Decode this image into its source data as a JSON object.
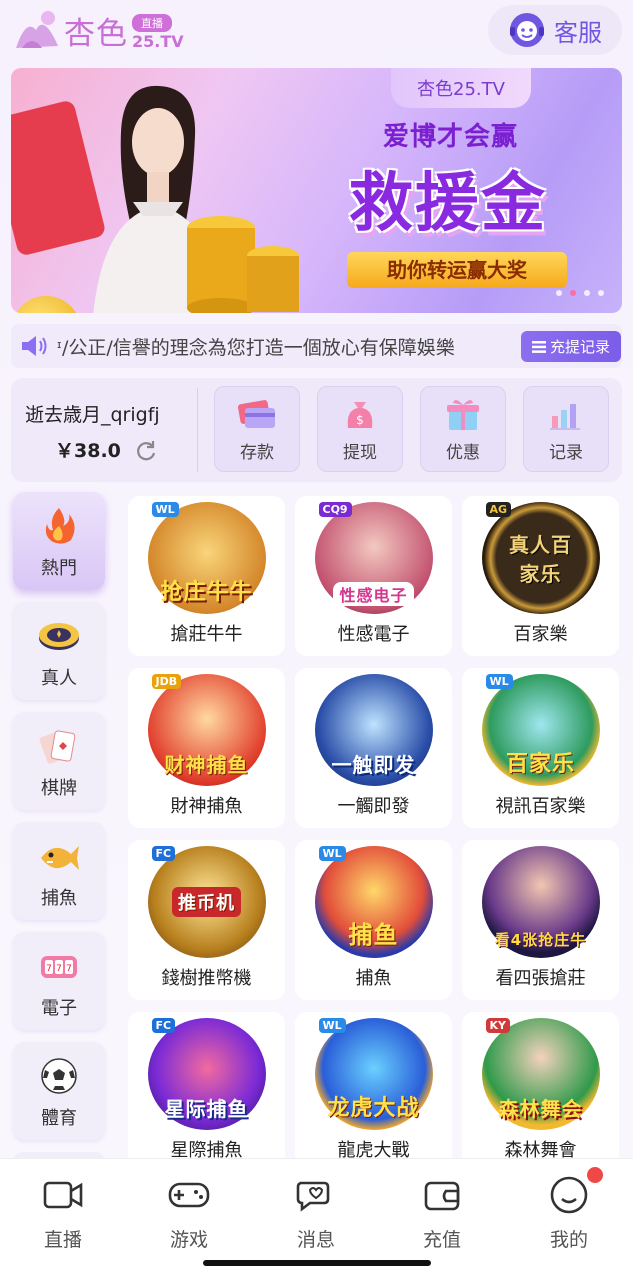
{
  "header": {
    "logo_text": "杏色",
    "logo_badge": "直播",
    "logo_domain": "25.TV",
    "service_label": "客服"
  },
  "banner": {
    "logo_text": "杏色25.TV",
    "slogan": "爱博才会赢",
    "headline": "救援金",
    "ribbon": "助你转运赢大奖",
    "dots": 4,
    "active_dot": 1
  },
  "marquee": {
    "text": "ᶦ/公正/信譽的理念為您打造一個放心有保障娛樂",
    "record_button": "充提记录"
  },
  "wallet": {
    "username": "逝去歳月_qrigfj",
    "balance": "￥38.0",
    "actions": [
      {
        "label": "存款",
        "icon": "card-icon"
      },
      {
        "label": "提现",
        "icon": "moneybag-icon"
      },
      {
        "label": "优惠",
        "icon": "gift-icon"
      },
      {
        "label": "记录",
        "icon": "bar-chart-icon"
      }
    ]
  },
  "categories": [
    {
      "label": "熱門",
      "icon": "fire-icon",
      "active": true
    },
    {
      "label": "真人",
      "icon": "chip-icon",
      "active": false
    },
    {
      "label": "棋牌",
      "icon": "cards-icon",
      "active": false
    },
    {
      "label": "捕魚",
      "icon": "fish-icon",
      "active": false
    },
    {
      "label": "電子",
      "icon": "slot-icon",
      "active": false
    },
    {
      "label": "體育",
      "icon": "soccer-icon",
      "active": false
    }
  ],
  "games": [
    {
      "name": "搶莊牛牛",
      "art_text": "抢庄牛牛",
      "tag": "WL"
    },
    {
      "name": "性感電子",
      "art_text": "性感电子",
      "tag": "CQ9"
    },
    {
      "name": "百家樂",
      "art_text": "真人百家乐",
      "tag": "AG"
    },
    {
      "name": "財神捕魚",
      "art_text": "财神捕鱼",
      "tag": "JDB"
    },
    {
      "name": "一觸即發",
      "art_text": "一触即发",
      "tag": ""
    },
    {
      "name": "視訊百家樂",
      "art_text": "百家乐",
      "tag": "WL"
    },
    {
      "name": "錢樹推幣機",
      "art_text": "推币机",
      "tag": "FC"
    },
    {
      "name": "捕魚",
      "art_text": "捕鱼",
      "tag": "WL"
    },
    {
      "name": "看四張搶莊",
      "art_text": "看4张抢庄牛",
      "tag": ""
    },
    {
      "name": "星際捕魚",
      "art_text": "星际捕鱼",
      "tag": "FC"
    },
    {
      "name": "龍虎大戰",
      "art_text": "龙虎大战",
      "tag": "WL"
    },
    {
      "name": "森林舞會",
      "art_text": "森林舞会",
      "tag": "KY"
    }
  ],
  "bottom_nav": [
    {
      "label": "直播",
      "icon": "video-camera-icon"
    },
    {
      "label": "游戏",
      "icon": "gamepad-icon"
    },
    {
      "label": "消息",
      "icon": "chat-icon"
    },
    {
      "label": "充值",
      "icon": "wallet-icon"
    },
    {
      "label": "我的",
      "icon": "smiley-icon",
      "badge": true
    }
  ],
  "colors": {
    "accent": "#7b5de8",
    "brand": "#c86fd6",
    "badge_red": "#f04747"
  }
}
